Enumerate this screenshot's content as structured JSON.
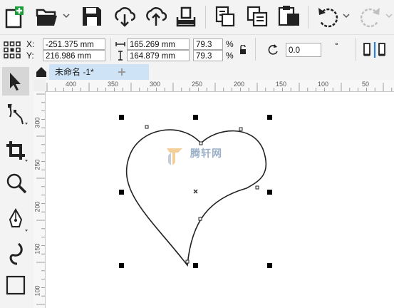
{
  "toolbar": {
    "icons": [
      "new-document-icon",
      "open-folder-icon",
      "save-icon",
      "download-icon",
      "upload-icon",
      "export-icon",
      "copy-icon",
      "paste-icon",
      "clipboard-icon",
      "undo-icon",
      "redo-icon"
    ]
  },
  "properties": {
    "x_label": "X:",
    "y_label": "Y:",
    "x_value": "-251.375 mm",
    "y_value": "216.986 mm",
    "width_value": "165.269 mm",
    "height_value": "164.879 mm",
    "scale_w": "79.3",
    "scale_h": "79.3",
    "percent": "%",
    "rotation": "0.0",
    "degree": "°"
  },
  "document": {
    "tab_title": "未命名 -1*"
  },
  "ruler": {
    "h_labels": [
      "400",
      "350",
      "300",
      "250",
      "200",
      "150",
      "100",
      "50"
    ],
    "v_labels": [
      "300",
      "250",
      "200",
      "150",
      "100"
    ]
  },
  "watermark": "腾轩网"
}
